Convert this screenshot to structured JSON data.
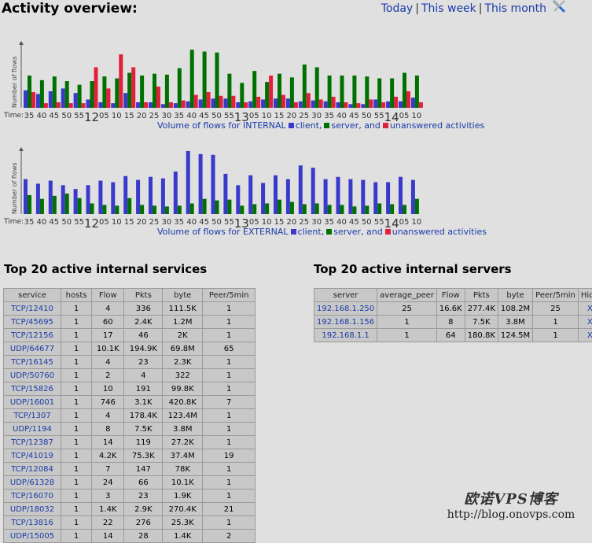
{
  "header": {
    "title": "Activity overview:",
    "ranges": [
      "Today",
      "This week",
      "This month"
    ],
    "separator": "|",
    "tools_icon": "tools-icon"
  },
  "chart_data": [
    {
      "type": "bar",
      "title": "",
      "ylabel": "Number of flows",
      "xlabel": "Time:",
      "caption": {
        "prefix": "Volume of flows for INTERNAL",
        "client": "client,",
        "server": "server, and",
        "unanswered": "unanswered activities"
      },
      "categories": [
        "35",
        "40",
        "45",
        "50",
        "55",
        "12",
        "05",
        "10",
        "15",
        "20",
        "25",
        "30",
        "35",
        "40",
        "45",
        "50",
        "55",
        "13",
        "05",
        "10",
        "15",
        "20",
        "25",
        "30",
        "35",
        "40",
        "45",
        "50",
        "55",
        "14",
        "05",
        "10"
      ],
      "hour_marks": {
        "5": "12",
        "17": "13",
        "29": "14"
      },
      "colors": {
        "client": "#3939cc",
        "server": "#007000",
        "unanswered": "#e3203c"
      },
      "series": [
        {
          "name": "client",
          "values": [
            19,
            15,
            18,
            21,
            16,
            9,
            6,
            5,
            16,
            6,
            6,
            4,
            5,
            7,
            9,
            10,
            10,
            6,
            7,
            9,
            10,
            10,
            7,
            8,
            7,
            6,
            4,
            4,
            9,
            7,
            7,
            11
          ]
        },
        {
          "name": "server",
          "values": [
            35,
            30,
            34,
            29,
            25,
            29,
            34,
            32,
            38,
            35,
            37,
            36,
            43,
            63,
            61,
            60,
            37,
            27,
            40,
            28,
            37,
            33,
            47,
            44,
            35,
            35,
            35,
            34,
            32,
            32,
            38,
            35
          ]
        },
        {
          "name": "unanswered",
          "values": [
            17,
            5,
            6,
            5,
            5,
            44,
            21,
            58,
            44,
            6,
            23,
            6,
            8,
            14,
            17,
            13,
            13,
            6,
            12,
            35,
            14,
            6,
            16,
            9,
            12,
            6,
            5,
            9,
            6,
            12,
            18,
            6
          ]
        }
      ],
      "ylim": [
        0,
        70
      ]
    },
    {
      "type": "bar",
      "title": "",
      "ylabel": "Number of flows",
      "xlabel": "Time:",
      "caption": {
        "prefix": "Volume of flows for EXTERNAL",
        "client": "client,",
        "server": "server, and",
        "unanswered": "unanswered activities"
      },
      "categories": [
        "35",
        "40",
        "45",
        "50",
        "55",
        "12",
        "05",
        "10",
        "15",
        "20",
        "25",
        "30",
        "35",
        "40",
        "45",
        "50",
        "55",
        "13",
        "05",
        "10",
        "15",
        "20",
        "25",
        "30",
        "35",
        "40",
        "45",
        "50",
        "55",
        "14",
        "05",
        "10"
      ],
      "hour_marks": {
        "5": "12",
        "17": "13",
        "29": "14"
      },
      "colors": {
        "client": "#3939cc",
        "server": "#007000",
        "unanswered": "#e3203c"
      },
      "series": [
        {
          "name": "client",
          "values": [
            46,
            40,
            44,
            38,
            33,
            38,
            44,
            42,
            50,
            45,
            49,
            47,
            56,
            83,
            79,
            78,
            53,
            38,
            51,
            41,
            51,
            46,
            64,
            61,
            46,
            49,
            46,
            45,
            42,
            42,
            49,
            45
          ]
        },
        {
          "name": "server",
          "values": [
            25,
            20,
            24,
            27,
            21,
            14,
            12,
            11,
            21,
            12,
            11,
            10,
            11,
            14,
            20,
            18,
            19,
            11,
            13,
            14,
            19,
            16,
            13,
            14,
            12,
            12,
            10,
            11,
            14,
            13,
            12,
            20
          ]
        },
        {
          "name": "unanswered",
          "values": [
            0,
            0,
            0,
            0,
            0,
            0,
            0,
            0,
            0,
            0,
            0,
            0,
            0,
            0,
            0,
            0,
            0,
            0,
            0,
            0,
            0,
            0,
            0,
            0,
            0,
            0,
            0,
            0,
            0,
            0,
            0,
            0
          ]
        }
      ],
      "ylim": [
        0,
        85
      ]
    }
  ],
  "services": {
    "title": "Top 20 active internal services",
    "columns": [
      "service",
      "hosts",
      "Flow",
      "Pkts",
      "byte",
      "Peer/5min"
    ],
    "rows": [
      [
        "TCP/12410",
        "1",
        "4",
        "336",
        "111.5K",
        "1"
      ],
      [
        "TCP/45695",
        "1",
        "60",
        "2.4K",
        "1.2M",
        "1"
      ],
      [
        "TCP/12156",
        "1",
        "17",
        "46",
        "2K",
        "1"
      ],
      [
        "UDP/64677",
        "1",
        "10.1K",
        "194.9K",
        "69.8M",
        "65"
      ],
      [
        "TCP/16145",
        "1",
        "4",
        "23",
        "2.3K",
        "1"
      ],
      [
        "UDP/50760",
        "1",
        "2",
        "4",
        "322",
        "1"
      ],
      [
        "TCP/15826",
        "1",
        "10",
        "191",
        "99.8K",
        "1"
      ],
      [
        "UDP/16001",
        "1",
        "746",
        "3.1K",
        "420.8K",
        "7"
      ],
      [
        "TCP/1307",
        "1",
        "4",
        "178.4K",
        "123.4M",
        "1"
      ],
      [
        "UDP/1194",
        "1",
        "8",
        "7.5K",
        "3.8M",
        "1"
      ],
      [
        "TCP/12387",
        "1",
        "14",
        "119",
        "27.2K",
        "1"
      ],
      [
        "TCP/41019",
        "1",
        "4.2K",
        "75.3K",
        "37.4M",
        "19"
      ],
      [
        "TCP/12084",
        "1",
        "7",
        "147",
        "78K",
        "1"
      ],
      [
        "UDP/61328",
        "1",
        "24",
        "66",
        "10.1K",
        "1"
      ],
      [
        "TCP/16070",
        "1",
        "3",
        "23",
        "1.9K",
        "1"
      ],
      [
        "UDP/18032",
        "1",
        "1.4K",
        "2.9K",
        "270.4K",
        "21"
      ],
      [
        "TCP/13816",
        "1",
        "22",
        "276",
        "25.3K",
        "1"
      ],
      [
        "UDP/15005",
        "1",
        "14",
        "28",
        "1.4K",
        "2"
      ]
    ]
  },
  "servers": {
    "title": "Top 20 active internal servers",
    "columns": [
      "server",
      "average_peer",
      "Flow",
      "Pkts",
      "byte",
      "Peer/5min",
      "Hide"
    ],
    "rows": [
      [
        "192.168.1.250",
        "25",
        "16.6K",
        "277.4K",
        "108.2M",
        "25",
        "X"
      ],
      [
        "192.168.1.156",
        "1",
        "8",
        "7.5K",
        "3.8M",
        "1",
        "X"
      ],
      [
        "192.168.1.1",
        "1",
        "64",
        "180.8K",
        "124.5M",
        "1",
        "X"
      ]
    ]
  },
  "watermark": {
    "line1": "欧诺VPS博客",
    "line2": "http://blog.onovps.com"
  }
}
